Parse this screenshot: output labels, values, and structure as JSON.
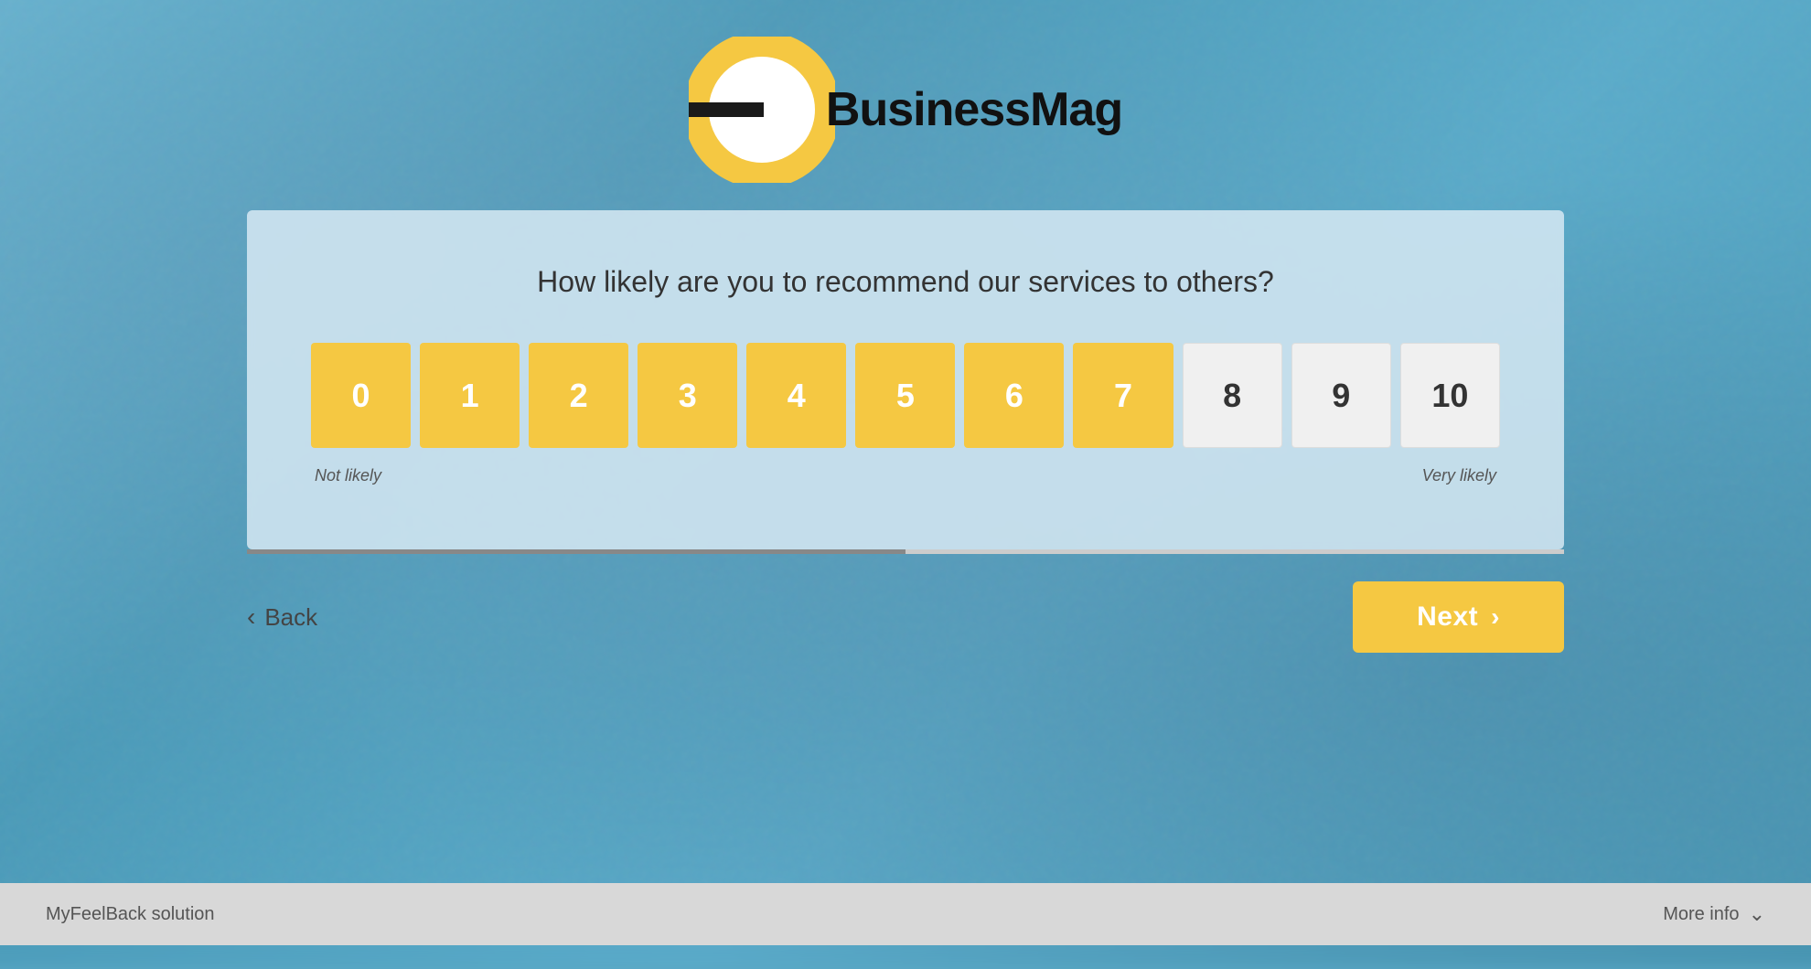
{
  "logo": {
    "text": "BusinessMag",
    "ring_color": "#f5c842",
    "ring_inner_color": "#fff"
  },
  "survey": {
    "question": "How likely are you to recommend our services to others?",
    "rating_options": [
      {
        "value": "0",
        "style": "yellow"
      },
      {
        "value": "1",
        "style": "yellow"
      },
      {
        "value": "2",
        "style": "yellow"
      },
      {
        "value": "3",
        "style": "yellow"
      },
      {
        "value": "4",
        "style": "yellow"
      },
      {
        "value": "5",
        "style": "yellow"
      },
      {
        "value": "6",
        "style": "yellow"
      },
      {
        "value": "7",
        "style": "yellow"
      },
      {
        "value": "8",
        "style": "white"
      },
      {
        "value": "9",
        "style": "white"
      },
      {
        "value": "10",
        "style": "white"
      }
    ],
    "label_left": "Not likely",
    "label_right": "Very likely"
  },
  "navigation": {
    "back_label": "Back",
    "next_label": "Next",
    "progress_percent": 50
  },
  "footer": {
    "left_text": "MyFeelBack solution",
    "right_text": "More info"
  }
}
